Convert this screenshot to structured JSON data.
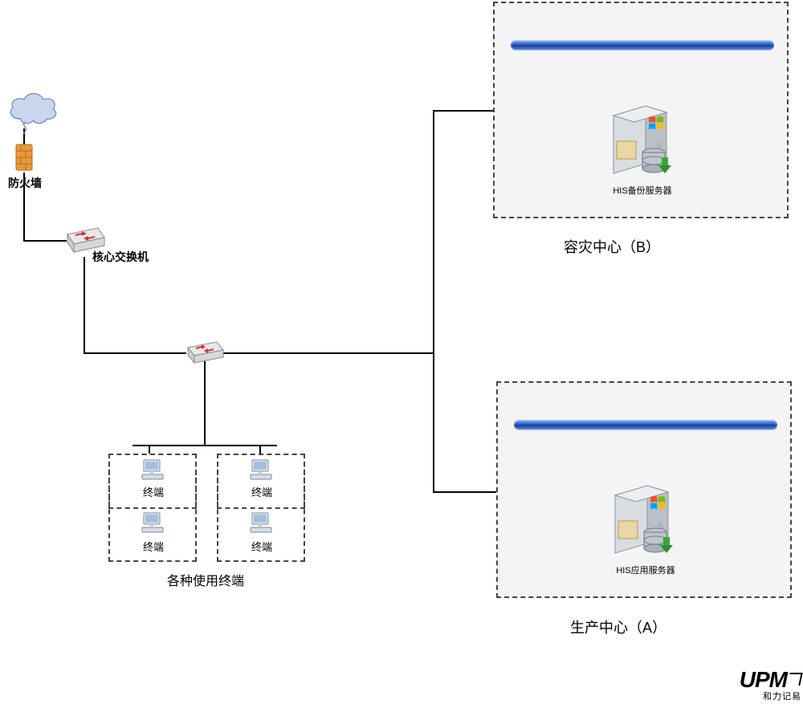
{
  "labels": {
    "firewall": "防火墙",
    "core_switch": "核心交换机",
    "terminals_caption": "各种使用终端",
    "terminal": "终端",
    "dr_center": "容灾中心（B）",
    "prod_center": "生产中心（A）",
    "backup_server": "HIS备份服务器",
    "app_server": "HIS应用服务器"
  },
  "logo": {
    "name": "UPM",
    "tagline": "和力记易"
  }
}
